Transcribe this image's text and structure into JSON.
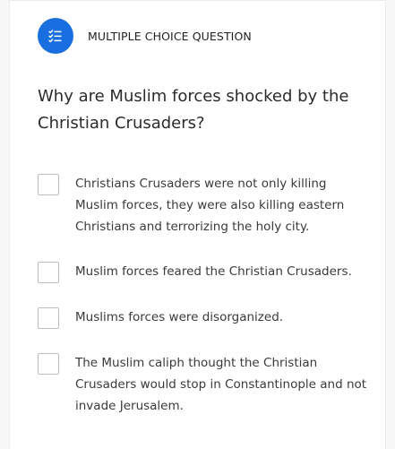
{
  "question_type": "MULTIPLE CHOICE QUESTION",
  "question_text": "Why are Muslim forces shocked by the Christian Crusaders?",
  "options": [
    {
      "label": "Christians Crusaders were not only killing Muslim forces, they were also killing eastern Christians and terrorizing the holy city.",
      "checked": false
    },
    {
      "label": "Muslim forces feared the Christian Crusaders.",
      "checked": false
    },
    {
      "label": "Muslims forces were disorganized.",
      "checked": false
    },
    {
      "label": "The Muslim caliph thought the Christian Crusaders would stop in Constantinople and not invade Jerusalem.",
      "checked": false
    }
  ],
  "colors": {
    "accent": "#1a6fe0",
    "text": "#2b2b2b",
    "checkbox_border": "#bdbdbd"
  },
  "icons": {
    "question_type_icon": "checklist-icon"
  }
}
